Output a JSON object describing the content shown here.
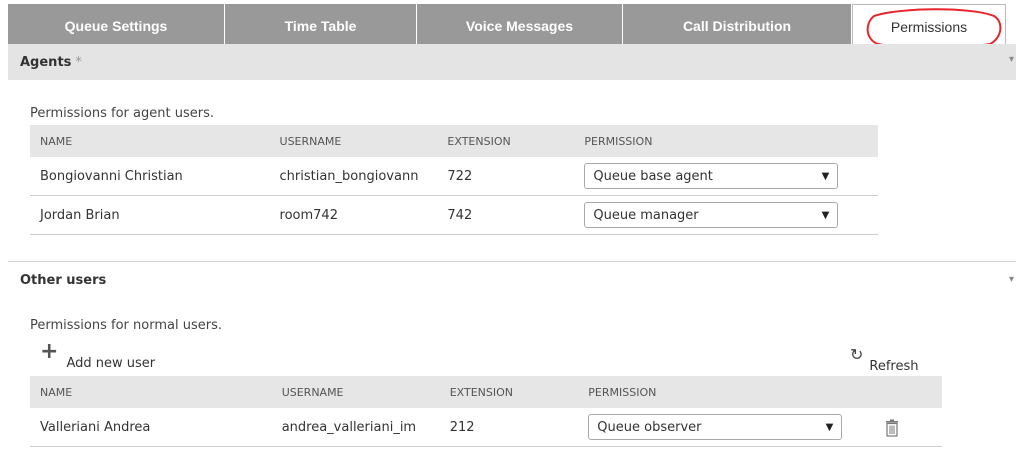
{
  "tabs": [
    {
      "label": "Queue Settings",
      "active": false
    },
    {
      "label": "Time Table",
      "active": false
    },
    {
      "label": "Voice Messages",
      "active": false
    },
    {
      "label": "Call Distribution",
      "active": false
    },
    {
      "label": "Permissions",
      "active": true
    }
  ],
  "colors": {
    "tab_bg": "#999999",
    "section_bg": "#e4e4e4",
    "annotation": "#e8242b"
  },
  "agents": {
    "title": "Agents",
    "required_mark": "*",
    "description": "Permissions for agent users.",
    "columns": [
      "NAME",
      "USERNAME",
      "EXTENSION",
      "PERMISSION"
    ],
    "rows": [
      {
        "name": "Bongiovanni Christian",
        "username": "christian_bongiovann",
        "extension": "722",
        "permission": "Queue base agent"
      },
      {
        "name": "Jordan Brian",
        "username": "room742",
        "extension": "742",
        "permission": "Queue manager"
      }
    ]
  },
  "other_users": {
    "title": "Other users",
    "description": "Permissions for normal users.",
    "add_label": "Add new user",
    "refresh_label": "Refresh",
    "columns": [
      "NAME",
      "USERNAME",
      "EXTENSION",
      "PERMISSION"
    ],
    "rows": [
      {
        "name": "Valleriani Andrea",
        "username": "andrea_valleriani_im",
        "extension": "212",
        "permission": "Queue observer"
      }
    ]
  },
  "icons": {
    "add": "plus-icon",
    "refresh": "refresh-icon",
    "delete": "trash-icon",
    "dropdown": "chevron-down-icon"
  }
}
